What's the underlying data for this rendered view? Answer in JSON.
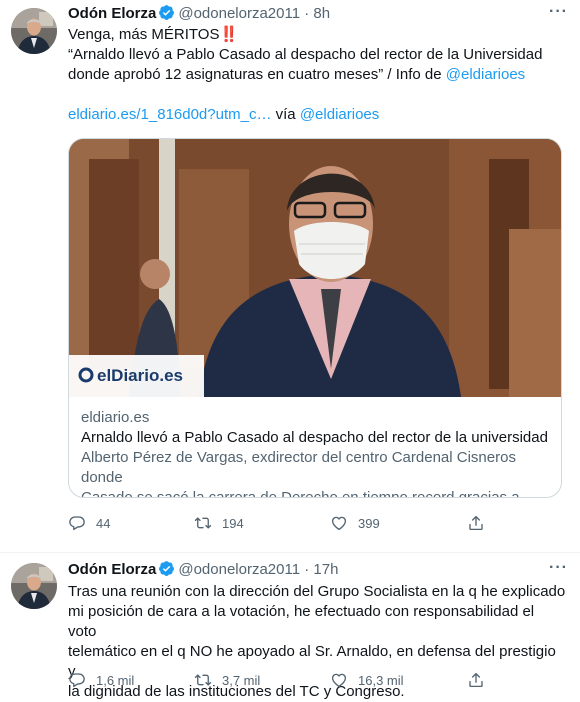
{
  "tweets": [
    {
      "author": "Odón Elorza",
      "handle": "@odonelorza2011",
      "separator": "·",
      "time": "8h",
      "more": "···",
      "line1": "Venga, más MÉRITOS",
      "line1_emoji": "‼️",
      "line2": "“Arnaldo llevó a Pablo Casado al despacho del rector de la Universidad",
      "line3_pre": "donde aprobó 12 asignaturas en cuatro meses” / Info de ",
      "line3_link": "@eldiarioes",
      "link_url": "eldiario.es/1_816d0d?utm_c…",
      "via_word": " vía ",
      "via_handle": "@eldiarioes",
      "card": {
        "logo": "elDiario.es",
        "domain": "eldiario.es",
        "title": "Arnaldo llevó a Pablo Casado al despacho del rector de la universidad ...",
        "desc_line1": "Alberto Pérez de Vargas, exdirector del centro Cardenal Cisneros donde",
        "desc_line2": "Casado se sacó la carrera de Derecho en tiempo record gracias a eso…"
      },
      "stats": {
        "replies": "44",
        "retweets": "194",
        "likes": "399"
      }
    },
    {
      "author": "Odón Elorza",
      "handle": "@odonelorza2011",
      "separator": "·",
      "time": "17h",
      "more": "···",
      "lines": [
        "Tras una reunión con la dirección del Grupo Socialista en la q he explicado",
        "mi posición de cara a la votación, he efectuado con responsabilidad el voto",
        "telemático en el q NO he apoyado al Sr. Arnaldo, en defensa del prestigio y",
        "la dignidad de las instituciones del TC y Congreso."
      ],
      "stats": {
        "replies": "1,6 mil",
        "retweets": "3,7 mil",
        "likes": "16,3 mil"
      }
    }
  ],
  "colors": {
    "link": "#1d9bf0",
    "secondary": "#536471",
    "text": "#0f1419",
    "border": "#cfd9de"
  },
  "icons": [
    "verified-badge-icon",
    "more-icon",
    "reply-icon",
    "retweet-icon",
    "like-icon",
    "share-icon"
  ]
}
